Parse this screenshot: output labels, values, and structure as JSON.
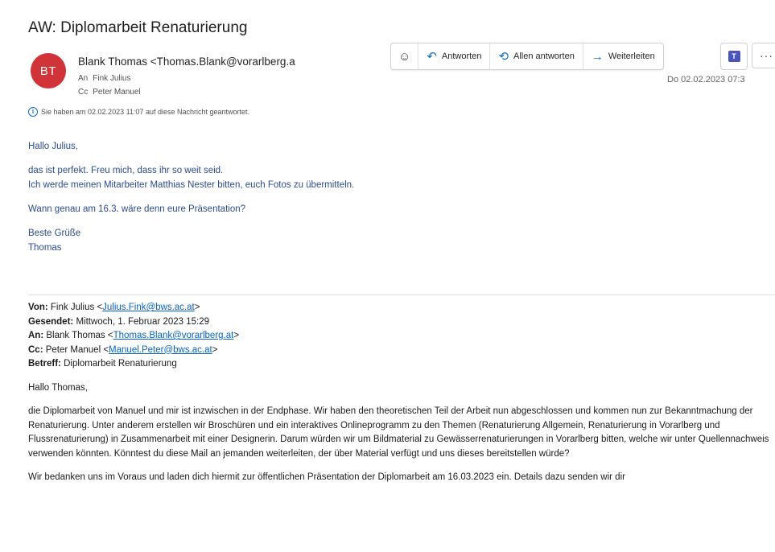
{
  "email": {
    "subject": "AW: Diplomarbeit Renaturierung",
    "avatar_initials": "BT",
    "avatar_color": "#d13438",
    "from": "Blank Thomas <Thomas.Blank@vorarlberg.a",
    "to_label": "An",
    "to_value": "Fink Julius",
    "cc_label": "Cc",
    "cc_value": "Peter Manuel",
    "info_icon": "info-icon",
    "info_text": "Sie haben am 02.02.2023 11:07 auf diese Nachricht geantwortet.",
    "date": "Do 02.02.2023 07:3"
  },
  "toolbar": {
    "emoji_icon": "emoji-icon",
    "reply_icon": "reply-arrow-icon",
    "reply_label": "Antworten",
    "reply_all_icon": "reply-all-arrow-icon",
    "reply_all_label": "Allen antworten",
    "forward_icon": "forward-arrow-icon",
    "forward_label": "Weiterleiten",
    "teams_icon": "teams-icon",
    "more_icon": "more-icon",
    "accent": "#0f6cbd"
  },
  "reply_body": {
    "greeting": "Hallo Julius,",
    "line1": "das ist perfekt. Freu mich, dass ihr so weit seid.",
    "line2": "Ich werde meinen Mitarbeiter Matthias Nester bitten, euch Fotos zu übermitteln.",
    "question": "Wann genau am 16.3. wäre denn eure Präsentation?",
    "closing": "Beste Grüße",
    "signature": "Thomas",
    "color": "#2b4b90"
  },
  "quoted": {
    "von_label": "Von:",
    "von_name": "Fink Julius <",
    "von_email": "Julius.Fink@bws.ac.at",
    "von_close": ">",
    "gesendet_label": "Gesendet:",
    "gesendet_value": "Mittwoch, 1. Februar 2023 15:29",
    "an_label": "An:",
    "an_name": "Blank Thomas <",
    "an_email": "Thomas.Blank@vorarlberg.at",
    "an_close": ">",
    "cc_label": "Cc:",
    "cc_name": "Peter Manuel <",
    "cc_email": "Manuel.Peter@bws.ac.at",
    "cc_close": ">",
    "betreff_label": "Betreff:",
    "betreff_value": "Diplomarbeit Renaturierung",
    "greeting": "Hallo Thomas,",
    "para1": "die Diplomarbeit von Manuel und mir ist inzwischen in der Endphase. Wir haben den theoretischen Teil der Arbeit nun abgeschlossen und kommen nun zur Bekanntmachung der Renaturierung. Unter anderem erstellen wir Broschüren und ein interaktives Onlineprogramm zu den Themen (Renaturierung Allgemein, Renaturierung in Vorarlberg und Flussrenaturierung) in Zusammenarbeit mit einer Designerin. Darum würden wir um Bildmaterial zu Gewässerrenaturierungen in Vorarlberg bitten, welche wir unter Quellennachweis verwenden könnten. Könntest du diese Mail an jemanden weiterleiten, der über Material verfügt und uns dieses bereitstellen würde?",
    "para2": "Wir bedanken uns im Voraus und laden dich hiermit zur öffentlichen Präsentation der Diplomarbeit am 16.03.2023 ein. Details dazu senden wir dir"
  }
}
